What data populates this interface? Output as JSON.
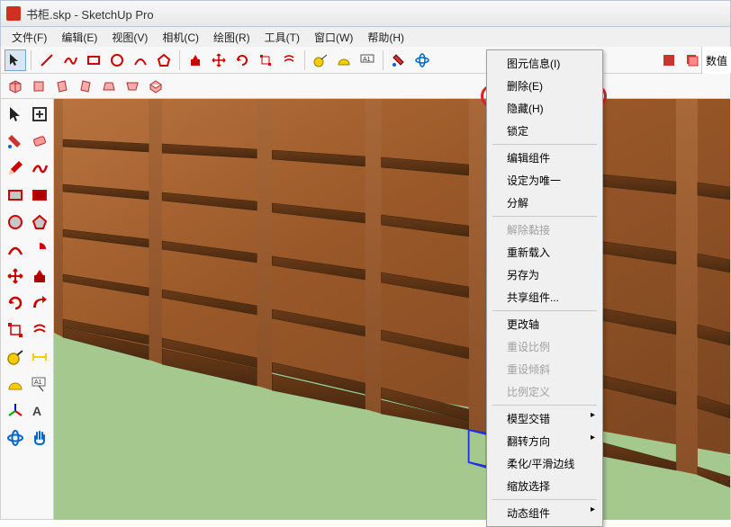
{
  "title": {
    "filename": "书柜.skp",
    "appname": "SketchUp Pro"
  },
  "menubar": [
    {
      "label": "文件(F)"
    },
    {
      "label": "编辑(E)"
    },
    {
      "label": "视图(V)"
    },
    {
      "label": "相机(C)"
    },
    {
      "label": "绘图(R)"
    },
    {
      "label": "工具(T)"
    },
    {
      "label": "窗口(W)"
    },
    {
      "label": "帮助(H)"
    }
  ],
  "context_menu": {
    "items": [
      {
        "label": "图元信息(I)",
        "enabled": true
      },
      {
        "label": "删除(E)",
        "enabled": true
      },
      {
        "label": "隐藏(H)",
        "enabled": true,
        "highlighted": true
      },
      {
        "label": "锁定",
        "enabled": true
      },
      {
        "type": "divider"
      },
      {
        "label": "编辑组件",
        "enabled": true
      },
      {
        "label": "设定为唯一",
        "enabled": true
      },
      {
        "label": "分解",
        "enabled": true
      },
      {
        "type": "divider"
      },
      {
        "label": "解除黏接",
        "enabled": false
      },
      {
        "label": "重新载入",
        "enabled": true
      },
      {
        "label": "另存为",
        "enabled": true
      },
      {
        "label": "共享组件...",
        "enabled": true
      },
      {
        "type": "divider"
      },
      {
        "label": "更改轴",
        "enabled": true
      },
      {
        "label": "重设比例",
        "enabled": false
      },
      {
        "label": "重设倾斜",
        "enabled": false
      },
      {
        "label": "比例定义",
        "enabled": false
      },
      {
        "type": "divider"
      },
      {
        "label": "模型交错",
        "enabled": true,
        "submenu": true
      },
      {
        "label": "翻转方向",
        "enabled": true,
        "submenu": true
      },
      {
        "label": "柔化/平滑边线",
        "enabled": true
      },
      {
        "label": "缩放选择",
        "enabled": true
      },
      {
        "type": "divider"
      },
      {
        "label": "动态组件",
        "enabled": true,
        "submenu": true
      }
    ]
  },
  "right_label": "数值",
  "colors": {
    "highlight": "#d8232a",
    "floor": "#a5c88e",
    "wood_dark": "#7a4520",
    "wood_light": "#b0693a",
    "selection_blue": "#2030e0"
  }
}
